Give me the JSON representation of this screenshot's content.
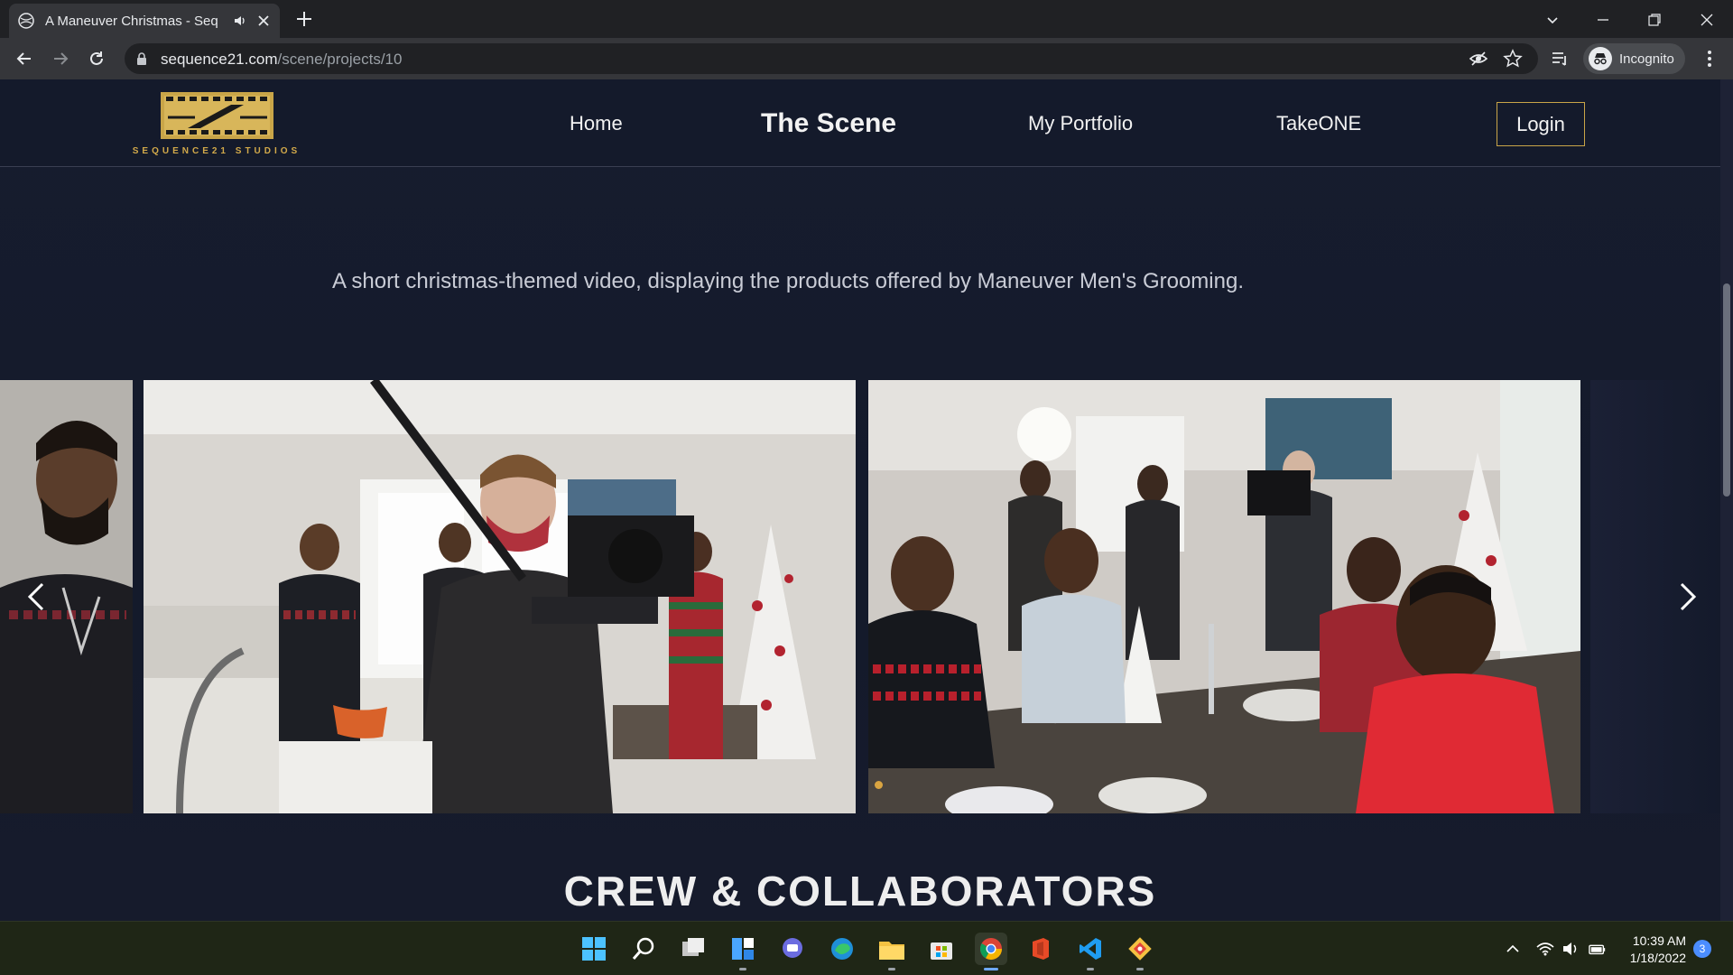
{
  "browser": {
    "tab_title": "A Maneuver Christmas - Seq",
    "url_host": "sequence21.com",
    "url_path": "/scene/projects/10",
    "profile_label": "Incognito"
  },
  "site": {
    "logo_text": "SEQUENCE21 STUDIOS",
    "nav": {
      "home": "Home",
      "scene": "The Scene",
      "portfolio": "My Portfolio",
      "takeone": "TakeONE",
      "login": "Login"
    },
    "description": "A short christmas-themed video, displaying the products offered by Maneuver Men's Grooming.",
    "section_heading": "CREW & COLLABORATORS",
    "colors": {
      "accent": "#c9a548",
      "background": "#141a2b",
      "dot_active": "#d9a441"
    }
  },
  "carousel": {
    "slides": [
      "man-profile-photo",
      "camera-operator-photo",
      "dinner-table-photo"
    ]
  },
  "taskbar": {
    "apps": [
      "start-icon",
      "search-icon",
      "task-view-icon",
      "widgets-icon",
      "teams-chat-icon",
      "edge-icon",
      "file-explorer-icon",
      "store-icon",
      "chrome-icon",
      "office-icon",
      "vscode-icon",
      "git-icon"
    ],
    "time": "10:39 AM",
    "date": "1/18/2022",
    "notification_count": "3"
  }
}
